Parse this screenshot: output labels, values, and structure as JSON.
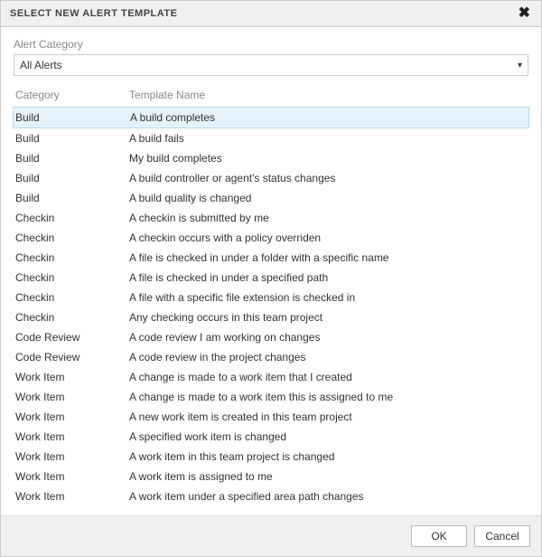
{
  "dialog": {
    "title": "SELECT NEW ALERT TEMPLATE",
    "close_icon": "✖"
  },
  "filter": {
    "label": "Alert Category",
    "selected": "All Alerts",
    "caret": "▾"
  },
  "columns": {
    "category": "Category",
    "template_name": "Template Name"
  },
  "rows": [
    {
      "category": "Build",
      "template": "A build completes",
      "selected": true
    },
    {
      "category": "Build",
      "template": "A build fails"
    },
    {
      "category": "Build",
      "template": "My build completes"
    },
    {
      "category": "Build",
      "template": "A build controller or agent's status changes"
    },
    {
      "category": "Build",
      "template": "A build quality is changed"
    },
    {
      "category": "Checkin",
      "template": "A checkin is submitted by me"
    },
    {
      "category": "Checkin",
      "template": "A checkin occurs with a policy overriden"
    },
    {
      "category": "Checkin",
      "template": "A file is checked in under a folder with a specific name"
    },
    {
      "category": "Checkin",
      "template": "A file is checked in under a specified path"
    },
    {
      "category": "Checkin",
      "template": "A file with a specific file extension is checked in"
    },
    {
      "category": "Checkin",
      "template": "Any checking occurs in this team project"
    },
    {
      "category": "Code Review",
      "template": "A code review I am working on changes"
    },
    {
      "category": "Code Review",
      "template": "A code review in the project changes"
    },
    {
      "category": "Work Item",
      "template": "A change is made to a work item that I created"
    },
    {
      "category": "Work Item",
      "template": "A change is made to a work item this is assigned to me"
    },
    {
      "category": "Work Item",
      "template": "A new work item is created in this team project"
    },
    {
      "category": "Work Item",
      "template": "A specified work item is changed"
    },
    {
      "category": "Work Item",
      "template": "A work item in this team project is changed"
    },
    {
      "category": "Work Item",
      "template": "A work item is assigned to me"
    },
    {
      "category": "Work Item",
      "template": "A work item under a specified area path changes"
    }
  ],
  "buttons": {
    "ok": "OK",
    "cancel": "Cancel"
  }
}
